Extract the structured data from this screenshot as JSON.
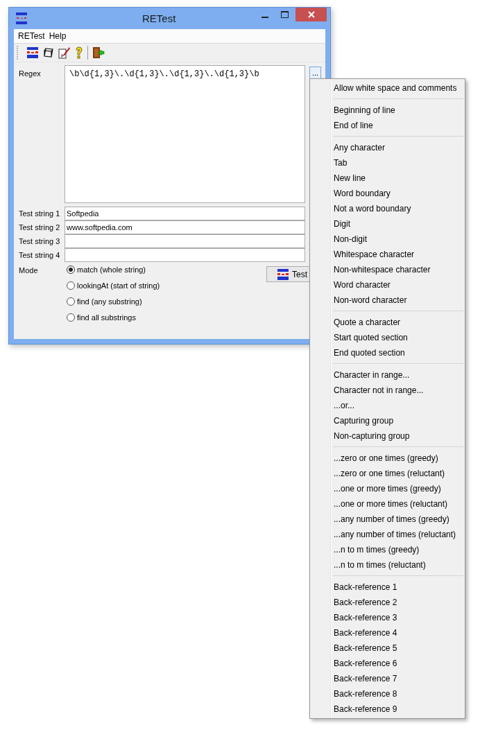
{
  "window": {
    "title": "RETest"
  },
  "menu_bar": [
    "RETest",
    "Help"
  ],
  "form": {
    "regex_label": "Regex",
    "regex": "\\b\\d{1,3}\\.\\d{1,3}\\.\\d{1,3}\\.\\d{1,3}\\b",
    "more_button": "...",
    "test_strings": [
      {
        "label": "Test string 1",
        "value": "Softpedia"
      },
      {
        "label": "Test string 2",
        "value": "www.softpedia.com"
      },
      {
        "label": "Test string 3"
      },
      {
        "label": "Test string 4"
      }
    ],
    "mode_label": "Mode",
    "modes": [
      {
        "label": "match (whole string)",
        "selected": true
      },
      {
        "label": "lookingAt (start of string)",
        "selected": false
      },
      {
        "label": "find (any substring)",
        "selected": false
      },
      {
        "label": "find all substrings",
        "selected": false
      }
    ],
    "test_button": "Test"
  },
  "popup_menu": {
    "sections": [
      {
        "items": [
          "Allow white space and comments"
        ]
      },
      {
        "items": [
          "Beginning of line",
          "End of line"
        ]
      },
      {
        "items": [
          "Any character",
          "Tab",
          "New line",
          "Word boundary",
          "Not a word boundary",
          "Digit",
          "Non-digit",
          "Whitespace character",
          "Non-whitespace character",
          "Word character",
          "Non-word character"
        ]
      },
      {
        "items": [
          "Quote a character",
          "Start quoted section",
          "End quoted section"
        ]
      },
      {
        "items": [
          "Character in range...",
          "Character not in range...",
          "...or...",
          "Capturing group",
          "Non-capturing group"
        ]
      },
      {
        "items": [
          "...zero or one times (greedy)",
          "...zero or one times (reluctant)",
          "...one or more times (greedy)",
          "...one or more times (reluctant)",
          "...any number of times (greedy)",
          "...any number of times (reluctant)",
          "...n to m times (greedy)",
          "...n to m times (reluctant)"
        ]
      },
      {
        "items": [
          "Back-reference 1",
          "Back-reference 2",
          "Back-reference 3",
          "Back-reference 4",
          "Back-reference 5",
          "Back-reference 6",
          "Back-reference 7",
          "Back-reference 8",
          "Back-reference 9"
        ]
      }
    ]
  }
}
